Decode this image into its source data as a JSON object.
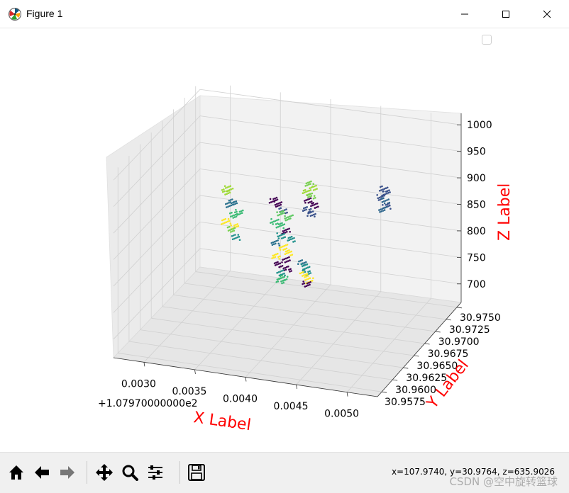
{
  "window": {
    "title": "Figure 1"
  },
  "chart_data": {
    "type": "scatter",
    "projection": "3d",
    "xlabel": "X Label",
    "ylabel": "Y Label",
    "zlabel": "Z Label",
    "axis_label_color": "#ff0000",
    "x_offset_text": "+1.07970000000e2",
    "x_ticks": [
      "0.0030",
      "0.0035",
      "0.0040",
      "0.0045",
      "0.0050"
    ],
    "y_ticks": [
      "30.9575",
      "30.9600",
      "30.9625",
      "30.9650",
      "30.9675",
      "30.9700",
      "30.9725",
      "30.9750"
    ],
    "z_ticks": [
      "700",
      "750",
      "800",
      "850",
      "900",
      "950",
      "1000"
    ],
    "xlim": [
      0.0027,
      0.0053
    ],
    "ylim": [
      30.9565,
      30.976
    ],
    "zlim": [
      665,
      1015
    ],
    "grid": true,
    "colormap": "viridis",
    "legend": "top-right, empty",
    "clusters": [
      {
        "x": [
          0.00325,
          0.0032,
          0.0033,
          0.00325,
          0.00335,
          0.00328,
          0.00322,
          0.0033,
          0.00326,
          0.00332
        ],
        "y": [
          30.97,
          30.9705,
          30.9698,
          30.9702,
          30.97,
          30.9703,
          30.9699,
          30.9701,
          30.9704,
          30.97
        ],
        "z": [
          880,
          868,
          858,
          848,
          838,
          828,
          818,
          810,
          800,
          790
        ],
        "colors": [
          "#a0da39",
          "#a0da39",
          "#2c728e",
          "#2c728e",
          "#3bbb75",
          "#3bbb75",
          "#fde725",
          "#fde725",
          "#7ad151",
          "#21918c"
        ]
      },
      {
        "x": [
          0.00378,
          0.00382,
          0.00388,
          0.00385,
          0.00392,
          0.00379,
          0.00384,
          0.0039,
          0.00386,
          0.00394,
          0.0038,
          0.00387,
          0.00393,
          0.00381,
          0.00389,
          0.00383,
          0.00391,
          0.00385,
          0.00388,
          0.00384
        ],
        "y": [
          30.968,
          30.9682,
          30.9679,
          30.9681,
          30.9683,
          30.968,
          30.9682,
          30.9681,
          30.9679,
          30.9683,
          30.968,
          30.9682,
          30.9681,
          30.9679,
          30.9683,
          30.968,
          30.9682,
          30.9681,
          30.968,
          30.9682
        ],
        "z": [
          890,
          882,
          874,
          866,
          858,
          850,
          842,
          834,
          826,
          818,
          810,
          802,
          794,
          786,
          778,
          770,
          762,
          754,
          746,
          738
        ],
        "colors": [
          "#440154",
          "#440154",
          "#3b528b",
          "#5ec962",
          "#5ec962",
          "#3bbb75",
          "#3bbb75",
          "#440154",
          "#21918c",
          "#21918c",
          "#2c728e",
          "#fde725",
          "#fde725",
          "#fde725",
          "#440154",
          "#440154",
          "#440154",
          "#21918c",
          "#3bbb75",
          "#3bbb75"
        ]
      },
      {
        "x": [
          0.00405,
          0.00408,
          0.00402,
          0.00406,
          0.00404,
          0.0041,
          0.00403,
          0.00407
        ],
        "y": [
          30.97,
          30.9701,
          30.9699,
          30.9702,
          30.97,
          30.9701,
          30.9699,
          30.97
        ],
        "z": [
          910,
          902,
          894,
          886,
          878,
          870,
          862,
          854
        ],
        "colors": [
          "#7ad151",
          "#a0da39",
          "#a0da39",
          "#7ad151",
          "#440154",
          "#440154",
          "#3b528b",
          "#3b528b"
        ]
      },
      {
        "x": [
          0.00415,
          0.00418,
          0.0042,
          0.00416,
          0.00422,
          0.00419
        ],
        "y": [
          30.966,
          30.9661,
          30.9659,
          30.9662,
          30.966,
          30.9661
        ],
        "z": [
          800,
          792,
          784,
          776,
          768,
          760
        ],
        "colors": [
          "#2c728e",
          "#21918c",
          "#21918c",
          "#fde725",
          "#fde725",
          "#440154"
        ]
      },
      {
        "x": [
          0.0047,
          0.00472,
          0.00468,
          0.00471,
          0.00473,
          0.00469
        ],
        "y": [
          30.972,
          30.9721,
          30.9719,
          30.9722,
          30.972,
          30.9721
        ],
        "z": [
          900,
          892,
          884,
          876,
          868,
          860
        ],
        "colors": [
          "#3b528b",
          "#3b528b",
          "#3b528b",
          "#31688e",
          "#3b528b",
          "#31688e"
        ]
      }
    ]
  },
  "toolbar": {
    "buttons": [
      {
        "name": "home-icon",
        "tooltip": "Reset original view"
      },
      {
        "name": "back-arrow-icon",
        "tooltip": "Back to previous view"
      },
      {
        "name": "forward-arrow-icon",
        "tooltip": "Forward to next view"
      },
      {
        "name": "pan-move-icon",
        "tooltip": "Pan axes"
      },
      {
        "name": "zoom-magnifier-icon",
        "tooltip": "Zoom to rectangle"
      },
      {
        "name": "configure-subplots-icon",
        "tooltip": "Configure subplots"
      },
      {
        "name": "save-floppy-icon",
        "tooltip": "Save the figure"
      }
    ],
    "coords": "x=107.9740, y=30.9764, z=635.9026"
  },
  "watermark": "CSDN @空中旋转篮球"
}
